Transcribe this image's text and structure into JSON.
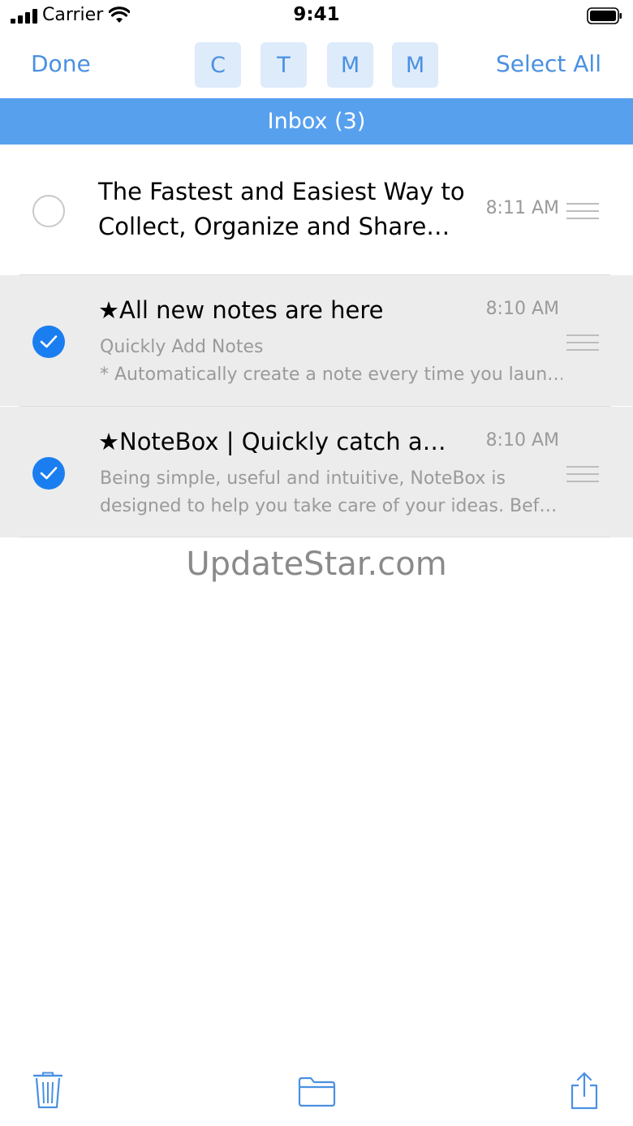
{
  "status_bar": {
    "carrier": "Carrier",
    "time": "9:41"
  },
  "nav": {
    "done_label": "Done",
    "select_all_label": "Select All",
    "tags": [
      "C",
      "T",
      "M",
      "M"
    ]
  },
  "section": {
    "title": "Inbox (3)"
  },
  "notes": [
    {
      "title_line1": "The Fastest and Easiest Way to",
      "title_line2": "Collect, Organize and Share…",
      "time": "8:11 AM",
      "selected": false
    },
    {
      "title": "★All new notes are here",
      "preview_line1": "Quickly Add Notes",
      "preview_line2": "* Automatically create a note every time you laun…",
      "time": "8:10 AM",
      "selected": true
    },
    {
      "title": "★NoteBox | Quickly catch a…",
      "preview_line1": "Being simple, useful and intuitive, NoteBox is",
      "preview_line2": "designed to help you take care of your ideas. Bef…",
      "time": "8:10 AM",
      "selected": true
    }
  ],
  "watermark": "UpdateStar.com",
  "toolbar": {
    "icons": [
      "trash-icon",
      "folder-icon",
      "share-icon"
    ]
  },
  "colors": {
    "accent": "#4a90e2",
    "header": "#57a0ee",
    "check": "#1a7ef0",
    "selected_row": "#ececec"
  }
}
